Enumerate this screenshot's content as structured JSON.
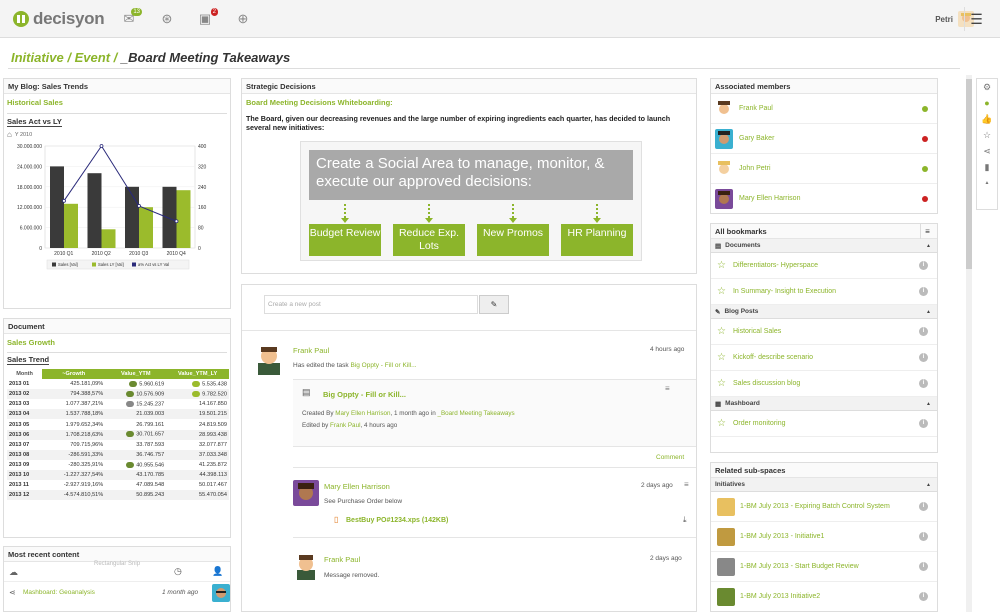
{
  "app": {
    "logo_text": "decisyon"
  },
  "topbar": {
    "mail_badge": "13",
    "tasks_badge": "2",
    "user_name": "Petri"
  },
  "breadcrumb": {
    "items": [
      "Initiative",
      "Event"
    ],
    "sep": "/",
    "current": "_Board Meeting Takeaways"
  },
  "blog": {
    "title": "My Blog: Sales Trends",
    "subtitle": "Historical Sales",
    "chart_title": "Sales Act vs LY",
    "crumb_label": "Y 2010"
  },
  "chart_data": {
    "type": "bar",
    "categories": [
      "2010 Q1",
      "2010 Q2",
      "2010 Q3",
      "2010 Q4"
    ],
    "series": [
      {
        "name": "Sales [Val]",
        "values": [
          24000000,
          22000000,
          18000000,
          18000000
        ],
        "color": "#3a3a3a"
      },
      {
        "name": "Sales LY [Val]",
        "values": [
          13000000,
          5500000,
          12000000,
          17000000
        ],
        "color": "#9bbb2c"
      },
      {
        "name": "a% Act vs LY Val",
        "values": [
          185,
          400,
          165,
          105
        ],
        "color": "#2a2a7a",
        "axis": "right"
      }
    ],
    "y_ticks": [
      "30.000.000",
      "24.000.000",
      "18.000.000",
      "12.000.000",
      "6.000.000",
      "0"
    ],
    "y2_ticks": [
      "400",
      "320",
      "240",
      "160",
      "80",
      "0"
    ],
    "ylim": [
      0,
      30000000
    ],
    "y2lim": [
      0,
      400
    ]
  },
  "document": {
    "title": "Document",
    "subtitle": "Sales Growth",
    "table_title": "Sales Trend",
    "columns": [
      "Month",
      "~Growth",
      "Value_YTM",
      "Value_YTM_LY"
    ],
    "rows": [
      [
        "2013 01",
        "425.181,09%",
        "5.960.619",
        "5.535.438"
      ],
      [
        "2013 02",
        "794.388,57%",
        "10.576.909",
        "9.782.520"
      ],
      [
        "2013 03",
        "1.077.387,21%",
        "15.245.237",
        "14.167.850"
      ],
      [
        "2013 04",
        "1.537.788,18%",
        "21.039.003",
        "19.501.215"
      ],
      [
        "2013 05",
        "1.979.652,34%",
        "26.799.161",
        "24.819.509"
      ],
      [
        "2013 06",
        "1.708.218,63%",
        "30.701.657",
        "28.993.438"
      ],
      [
        "2013 07",
        "709.715,96%",
        "33.787.593",
        "32.077.877"
      ],
      [
        "2013 08",
        "-286.591,33%",
        "36.746.757",
        "37.033.348"
      ],
      [
        "2013 09",
        "-280.325,91%",
        "40.955.546",
        "41.235.872"
      ],
      [
        "2013 10",
        "-1.227.327,54%",
        "43.170.785",
        "44.398.113"
      ],
      [
        "2013 11",
        "-2.927.919,16%",
        "47.089.548",
        "50.017.467"
      ],
      [
        "2013 12",
        "-4.574.810,51%",
        "50.895.243",
        "55.470.054"
      ]
    ]
  },
  "recent": {
    "title": "Most recent content",
    "ghost": "Rectangular Snip",
    "item_label": "Mashboard: Geoanalysis",
    "item_time": "1 month ago"
  },
  "strategic": {
    "title": "Strategic Decisions",
    "subtitle": "Board Meeting Decisions Whiteboarding:",
    "body": "The Board, given our decreasing revenues and the large number of expiring ingredients each quarter, has decided to launch several new initiatives:",
    "banner": "Create a Social Area to manage, monitor, & execute our approved decisions:",
    "boxes": [
      "Budget Review",
      "Reduce Exp. Lots",
      "New Promos",
      "HR Planning"
    ]
  },
  "feed": {
    "placeholder": "Create a new post",
    "post1": {
      "author": "Frank Paul",
      "time": "4 hours ago",
      "action": "Has edited the task ",
      "link": "Big Oppty - Fill or Kill...",
      "task_title": "Big Oppty - Fill or Kill...",
      "created_prefix": "Created By ",
      "created_by": "Mary Ellen Harrison",
      "created_mid": ", 1 month ago in ",
      "created_in": "_Board Meeting Takeaways",
      "edited_prefix": "Edited by ",
      "edited_by": "Frank Paul",
      "edited_suffix": ", 4 hours ago",
      "comment": "Comment"
    },
    "post2": {
      "author": "Mary Ellen Harrison",
      "time": "2 days ago",
      "text": "See Purchase Order below",
      "file": "BestBuy PO#1234.xps (142KB)"
    },
    "post3": {
      "author": "Frank Paul",
      "time": "2 days ago",
      "text": "Message removed."
    }
  },
  "members": {
    "title": "Associated members",
    "list": [
      {
        "name": "Frank Paul",
        "status": "#8cb52b"
      },
      {
        "name": "Gary Baker",
        "status": "#cc2222"
      },
      {
        "name": "John Petri",
        "status": "#8cb52b"
      },
      {
        "name": "Mary Ellen Harrison",
        "status": "#cc2222"
      }
    ]
  },
  "bookmarks": {
    "title": "All bookmarks",
    "sections": [
      {
        "name": "Documents",
        "items": [
          "Differentiators- Hyperspace",
          "In Summary- Insight to Execution"
        ]
      },
      {
        "name": "Blog Posts",
        "items": [
          "Historical Sales",
          "Kickoff- describe scenario",
          "Sales discussion blog"
        ]
      },
      {
        "name": "Mashboard",
        "items": [
          "Order monitoring"
        ]
      }
    ]
  },
  "subspaces": {
    "title": "Related sub-spaces",
    "section": "Initiatives",
    "items": [
      "1-BM July 2013 - Expiring Batch Control System",
      "1-BM July 2013 - Initiative1",
      "1-BM July 2013 - Start Budget Review",
      "1-BM July 2013 Initiative2"
    ]
  }
}
